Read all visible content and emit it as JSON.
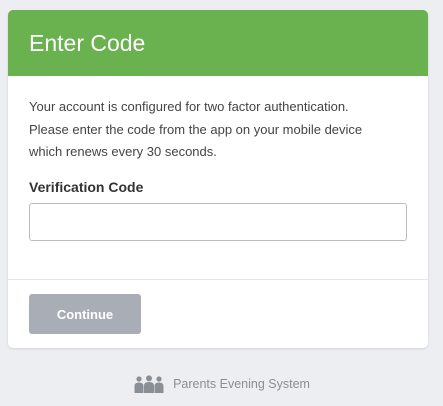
{
  "card": {
    "title": "Enter Code",
    "intro_line_1": "Your account is configured for two factor authentication.",
    "intro_line_2": "Please enter the code from the app on your mobile device",
    "intro_line_3": "which renews every 30 seconds.",
    "field_label": "Verification Code",
    "code_value": "",
    "continue_label": "Continue"
  },
  "footer": {
    "icon": "people-group-icon",
    "text": "Parents Evening System"
  },
  "colors": {
    "header_green": "#6ab150",
    "button_disabled_gray": "#a9aeb6",
    "page_background": "#eceef1"
  }
}
